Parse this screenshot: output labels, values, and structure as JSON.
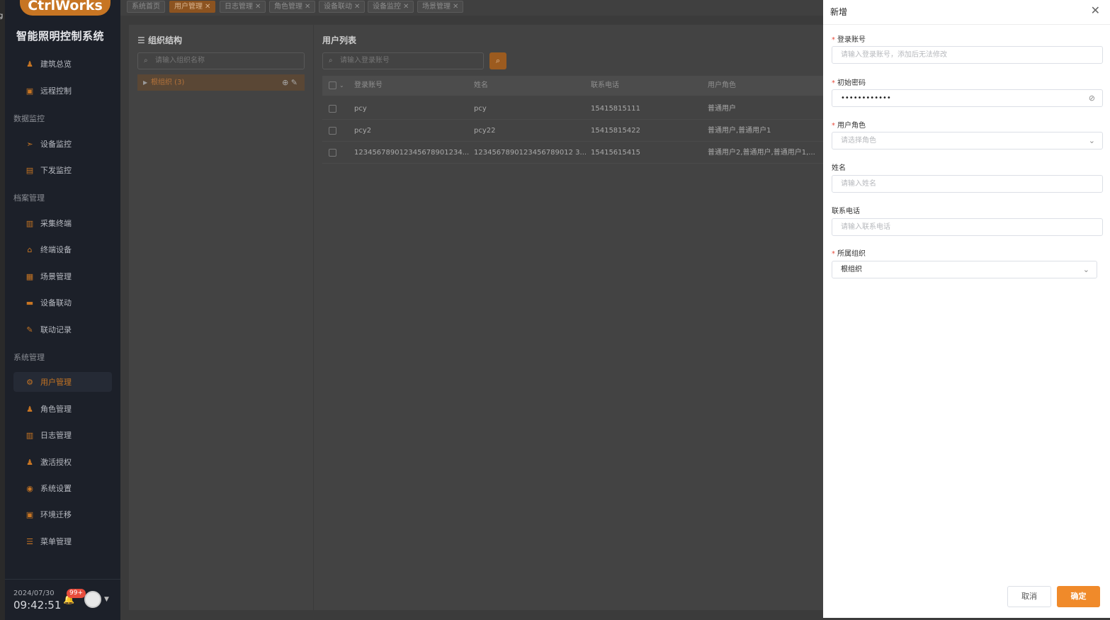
{
  "app": {
    "logo": "CtrlWorks",
    "title": "智能照明控制系统",
    "edge_char": "g"
  },
  "sidebar": {
    "items": [
      {
        "label": "建筑总览",
        "icon": "building-icon",
        "glyph": "♟"
      },
      {
        "label": "远程控制",
        "icon": "remote-control-icon",
        "glyph": "▣"
      },
      {
        "section": "数据监控"
      },
      {
        "label": "设备监控",
        "icon": "device-monitor-icon",
        "glyph": "➣"
      },
      {
        "label": "下发监控",
        "icon": "dispatch-monitor-icon",
        "glyph": "▤"
      },
      {
        "section": "档案管理"
      },
      {
        "label": "采集终端",
        "icon": "collector-icon",
        "glyph": "▥"
      },
      {
        "label": "终端设备",
        "icon": "terminal-device-icon",
        "glyph": "⌂"
      },
      {
        "label": "场景管理",
        "icon": "scene-icon",
        "glyph": "▦"
      },
      {
        "label": "设备联动",
        "icon": "device-link-icon",
        "glyph": "▬"
      },
      {
        "label": "联动记录",
        "icon": "link-record-icon",
        "glyph": "✎"
      },
      {
        "section": "系统管理"
      },
      {
        "label": "用户管理",
        "icon": "user-management-icon",
        "glyph": "⚙",
        "active": true
      },
      {
        "label": "角色管理",
        "icon": "role-icon",
        "glyph": "♟"
      },
      {
        "label": "日志管理",
        "icon": "log-icon",
        "glyph": "▥"
      },
      {
        "label": "激活授权",
        "icon": "license-icon",
        "glyph": "♟"
      },
      {
        "label": "系统设置",
        "icon": "settings-icon",
        "glyph": "◉"
      },
      {
        "label": "环境迁移",
        "icon": "migration-icon",
        "glyph": "▣"
      },
      {
        "label": "菜单管理",
        "icon": "menu-icon",
        "glyph": "☰"
      }
    ],
    "date": "2024/07/30",
    "time": "09:42:51",
    "notif_badge": "99+"
  },
  "tabs": [
    {
      "label": "系统首页",
      "closable": false
    },
    {
      "label": "用户管理",
      "closable": true,
      "active": true
    },
    {
      "label": "日志管理",
      "closable": true
    },
    {
      "label": "角色管理",
      "closable": true
    },
    {
      "label": "设备联动",
      "closable": true
    },
    {
      "label": "设备监控",
      "closable": true
    },
    {
      "label": "场景管理",
      "closable": true
    }
  ],
  "org": {
    "title": "组织结构",
    "search_placeholder": "请输入组织名称",
    "tree_root": "根组织 (3)"
  },
  "users": {
    "title": "用户列表",
    "search_placeholder": "请输入登录账号",
    "columns": [
      "登录账号",
      "姓名",
      "联系电话",
      "用户角色"
    ],
    "rows": [
      [
        "pcy",
        "pcy",
        "15415815111",
        "普通用户"
      ],
      [
        "pcy2",
        "pcy22",
        "15415815422",
        "普通用户,普通用户1"
      ],
      [
        "123456789012345678901234...",
        "1234567890123456789012 3...",
        "15415615415",
        "普通用户2,普通用户,普通用户1,..."
      ]
    ]
  },
  "drawer": {
    "title": "新增",
    "fields": [
      {
        "label": "登录账号",
        "required": true,
        "placeholder": "请输入登录账号，添加后无法修改",
        "value": ""
      },
      {
        "label": "初始密码",
        "required": true,
        "placeholder": "",
        "value": "••••••••••••"
      },
      {
        "label": "用户角色",
        "required": true,
        "placeholder": "请选择角色",
        "value": ""
      },
      {
        "label": "姓名",
        "required": false,
        "placeholder": "请输入姓名",
        "value": ""
      },
      {
        "label": "联系电话",
        "required": false,
        "placeholder": "请输入联系电话",
        "value": ""
      },
      {
        "label": "所属组织",
        "required": true,
        "placeholder": "",
        "value": "根组织"
      }
    ],
    "cancel": "取消",
    "confirm": "确定"
  },
  "colors": {
    "accent": "#f08a2a",
    "sidebar_bg": "#1c2029",
    "required": "#e74c3c"
  }
}
